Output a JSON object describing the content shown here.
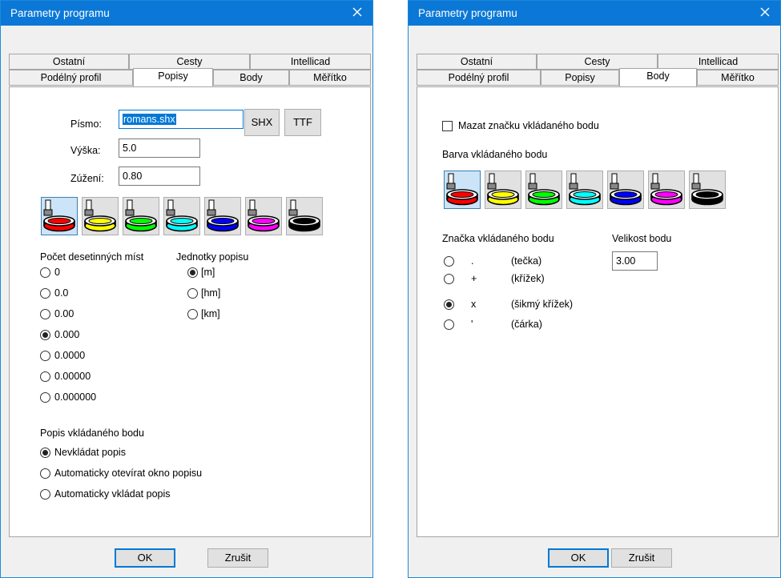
{
  "colors": {
    "titlebar": "#0b78d7",
    "accent": "#0078d7"
  },
  "dialogs": [
    {
      "title": "Parametry programu",
      "tabs_top": [
        "Ostatní",
        "Cesty",
        "Intellicad"
      ],
      "tabs_bottom": [
        "Podélný profil",
        "Popisy",
        "Body",
        "Měřítko"
      ],
      "active_tab": "Popisy",
      "font_label": "Písmo:",
      "font_value": "romans.shx",
      "shx_button": "SHX",
      "ttf_button": "TTF",
      "height_label": "Výška:",
      "height_value": "5.0",
      "narrow_label": "Zúžení:",
      "narrow_value": "0.80",
      "colors": [
        "red",
        "yellow",
        "green",
        "cyan",
        "blue",
        "magenta",
        "black"
      ],
      "selected_color": "red",
      "decimals_label": "Počet desetinných míst",
      "decimals": [
        "0",
        "0.0",
        "0.00",
        "0.000",
        "0.0000",
        "0.00000",
        "0.000000"
      ],
      "selected_decimal": "0.000",
      "units_label": "Jednotky popisu",
      "units": [
        "[m]",
        "[hm]",
        "[km]"
      ],
      "selected_unit": "[m]",
      "point_desc_label": "Popis vkládaného bodu",
      "point_desc_options": [
        "Nevkládat popis",
        "Automaticky otevírat okno popisu",
        "Automaticky vkládat popis"
      ],
      "selected_point_desc": "Nevkládat popis",
      "ok": "OK",
      "cancel": "Zrušit"
    },
    {
      "title": "Parametry programu",
      "tabs_top": [
        "Ostatní",
        "Cesty",
        "Intellicad"
      ],
      "tabs_bottom": [
        "Podélný profil",
        "Popisy",
        "Body",
        "Měřítko"
      ],
      "active_tab": "Body",
      "erase_label": "Mazat značku vkládaného bodu",
      "erase_checked": false,
      "color_label": "Barva vkládaného bodu",
      "colors": [
        "red",
        "yellow",
        "green",
        "cyan",
        "blue",
        "magenta",
        "black"
      ],
      "selected_color": "red",
      "mark_label": "Značka vkládaného bodu",
      "marks": [
        {
          "symbol": ".",
          "name": "(tečka)"
        },
        {
          "symbol": "+",
          "name": "(křížek)"
        },
        {
          "symbol": "x",
          "name": "(šikmý křížek)"
        },
        {
          "symbol": "'",
          "name": "(čárka)"
        }
      ],
      "selected_mark": "x",
      "size_label": "Velikost bodu",
      "size_value": "3.00",
      "ok": "OK",
      "cancel": "Zrušit"
    }
  ]
}
